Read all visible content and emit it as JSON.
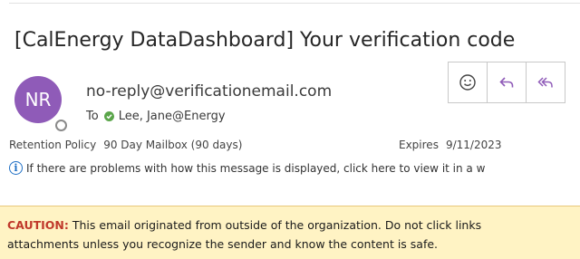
{
  "email": {
    "subject": "[CalEnergy DataDashboard] Your verification code",
    "avatar_initials": "NR",
    "sender": "no-reply@verificationemail.com",
    "to_label": "To",
    "recipient": "Lee, Jane@Energy",
    "retention_label": "Retention Policy",
    "retention_value": "90 Day Mailbox (90 days)",
    "expires_label": "Expires",
    "expires_value": "9/11/2023",
    "info_text": "If there are problems with how this message is displayed, click here to view it in a w"
  },
  "actions": [
    {
      "name": "emoji-react",
      "icon": "smiley-icon"
    },
    {
      "name": "reply",
      "icon": "reply-icon"
    },
    {
      "name": "reply-all",
      "icon": "reply-all-icon"
    }
  ],
  "caution": {
    "label": "CAUTION:",
    "line1": " This email originated from outside of the organization. Do not click links",
    "line2": "attachments unless you recognize the sender and know the content is safe."
  },
  "colors": {
    "avatar": "#8f5bb8",
    "accent": "#1f6fc5",
    "caution_bg": "#fff3c4",
    "caution_label": "#c0392b",
    "presence_ok": "#5aa54a"
  }
}
